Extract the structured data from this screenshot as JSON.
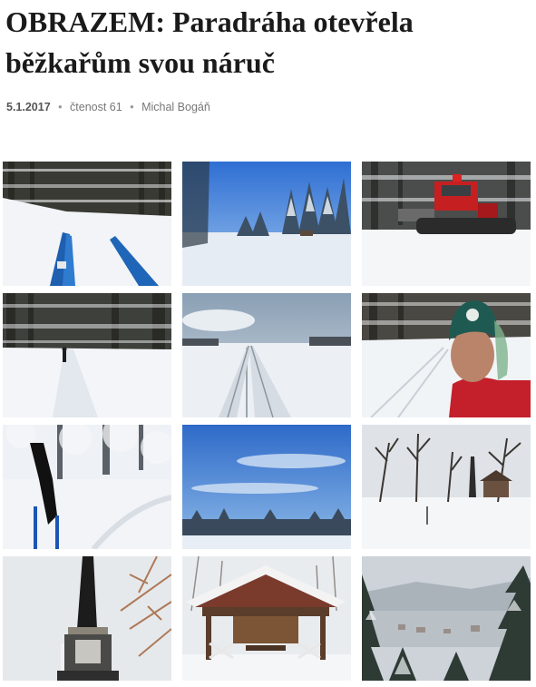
{
  "article": {
    "title": "OBRAZEM: Paradráha otevřela běžkařům svou náruč",
    "date": "5.1.2017",
    "separator": "•",
    "readership": "čtenost 61",
    "author": "Michal Bogáň"
  },
  "gallery": {
    "photos": [
      {
        "subject": "ski-tips-forest-trail-photo"
      },
      {
        "subject": "snowy-meadow-blue-sky-photo"
      },
      {
        "subject": "red-snow-groomer-photo"
      },
      {
        "subject": "skier-forest-track-photo"
      },
      {
        "subject": "ski-track-field-photo"
      },
      {
        "subject": "skier-selfie-photo"
      },
      {
        "subject": "ski-poles-snowy-forest-photo"
      },
      {
        "subject": "blue-sky-treeline-photo"
      },
      {
        "subject": "obelisk-winter-park-photo"
      },
      {
        "subject": "obelisk-monument-closeup-photo"
      },
      {
        "subject": "wooden-gazebo-snow-photo"
      },
      {
        "subject": "winter-valley-town-photo"
      }
    ]
  }
}
